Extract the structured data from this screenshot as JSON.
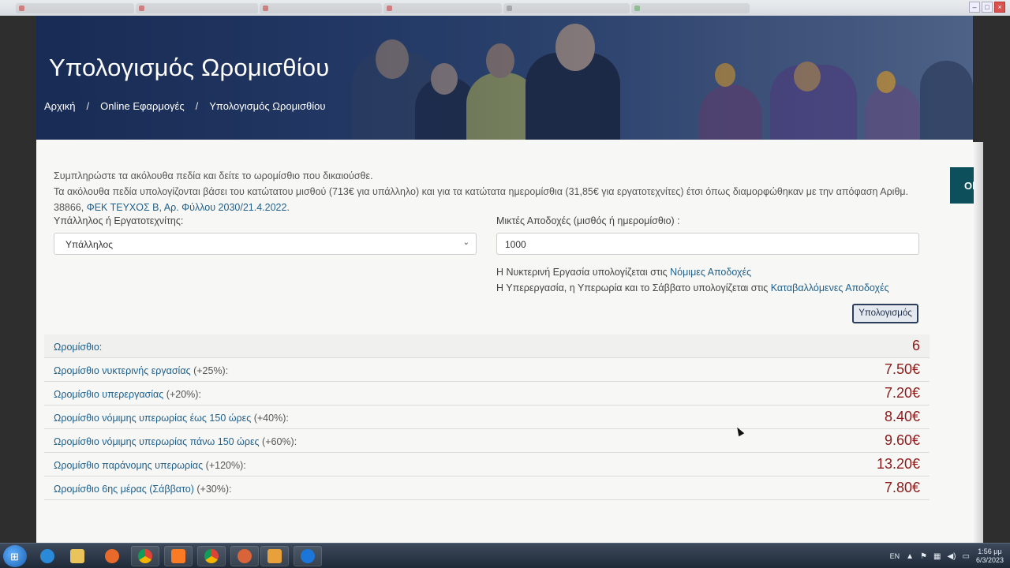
{
  "browser": {
    "tabs": [
      "",
      "",
      "",
      "",
      "",
      ""
    ]
  },
  "hero": {
    "title": "Υπολογισμός Ωρομισθίου",
    "breadcrumb": [
      "Αρχική",
      "Online Εφαρμογές",
      "Υπολογισμός Ωρομισθίου"
    ],
    "separator": "/"
  },
  "intro": {
    "line1": "Συμπληρώστε τα ακόλουθα πεδία και δείτε το ωρομίσθιο που δικαιούσθε.",
    "line2_text": "Τα ακόλουθα πεδία υπολογίζονται βάσει του κατώτατου μισθού (713€ για υπάλληλο) και για τα κατώτατα ημερομίσθια (31,85€ για εργατοτεχνίτες) έτσι όπως διαμορφώθηκαν με την απόφαση Αριθμ. 38866,",
    "line2_link": "ΦΕΚ ΤΕΥΧΟΣ Β, Αρ. Φύλλου 2030/21.4.2022."
  },
  "form": {
    "type_label": "Υπάλληλος ή Εργατοτεχνίτης:",
    "type_value": "Υπάλληλος",
    "salary_label": "Μικτές Αποδοχές (μισθός ή ημερομίσθιο) :",
    "salary_value": "1000",
    "note1_text": "Η Νυκτερινή Εργασία υπολογίζεται στις",
    "note1_link": "Νόμιμες Αποδοχές",
    "note2_text": "Η Υπερεργασία, η Υπερωρία και το Σάββατο υπολογίζεται στις",
    "note2_link": "Καταβαλλόμενες Αποδοχές",
    "calc_button": "Υπολογισμός"
  },
  "results": [
    {
      "label": "Ωρομίσθιο:",
      "pct": "",
      "value": "6"
    },
    {
      "label": "Ωρομίσθιο νυκτερινής εργασίας",
      "pct": "(+25%):",
      "value": "7.50€"
    },
    {
      "label": "Ωρομίσθιο υπερεργασίας",
      "pct": "(+20%):",
      "value": "7.20€"
    },
    {
      "label": "Ωρομίσθιο νόμιμης υπερωρίας έως 150 ώρες",
      "pct": "(+40%):",
      "value": "8.40€"
    },
    {
      "label": "Ωρομίσθιο νόμιμης υπερωρίας πάνω 150 ώρες",
      "pct": "(+60%):",
      "value": "9.60€"
    },
    {
      "label": "Ωρομίσθιο παράνομης υπερωρίας",
      "pct": "(+120%):",
      "value": "13.20€"
    },
    {
      "label": "Ωρομίσθιο 6ης μέρας (Σάββατο)",
      "pct": "(+30%):",
      "value": "7.80€"
    }
  ],
  "side_tab": "Ol",
  "taskbar": {
    "lang": "EN",
    "time": "1:56 μμ",
    "date": "6/3/2023"
  },
  "colors": {
    "hero": "#2c4470",
    "link": "#1f5f8b",
    "value": "#8b1a1a",
    "side_tab": "#0e4f5c"
  }
}
